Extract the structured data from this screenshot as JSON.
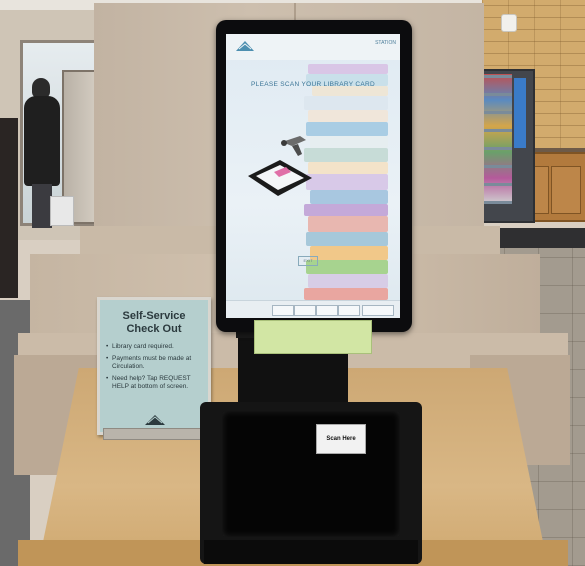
{
  "sign": {
    "title_line1": "Self-Service",
    "title_line2": "Check Out",
    "items": [
      "Library card required.",
      "Payments must be made at Circulation.",
      "Need help? Tap REQUEST HELP at bottom of screen."
    ]
  },
  "screen": {
    "station_label": "STATION",
    "prompt": "PLEASE SCAN YOUR LIBRARY CARD",
    "exit_label": "EXIT",
    "footer_buttons": [
      "",
      "",
      "",
      "",
      ""
    ]
  },
  "scanner": {
    "tag_label": "Scan Here"
  },
  "colors": {
    "sign_bg": "#b5cfce",
    "screen_accent": "#3b7596",
    "kiosk_body": "#111111",
    "table_wood": "#d9b785"
  },
  "icons": [
    "library-logo-icon",
    "barcode-scanner-icon",
    "card-reader-icon"
  ]
}
